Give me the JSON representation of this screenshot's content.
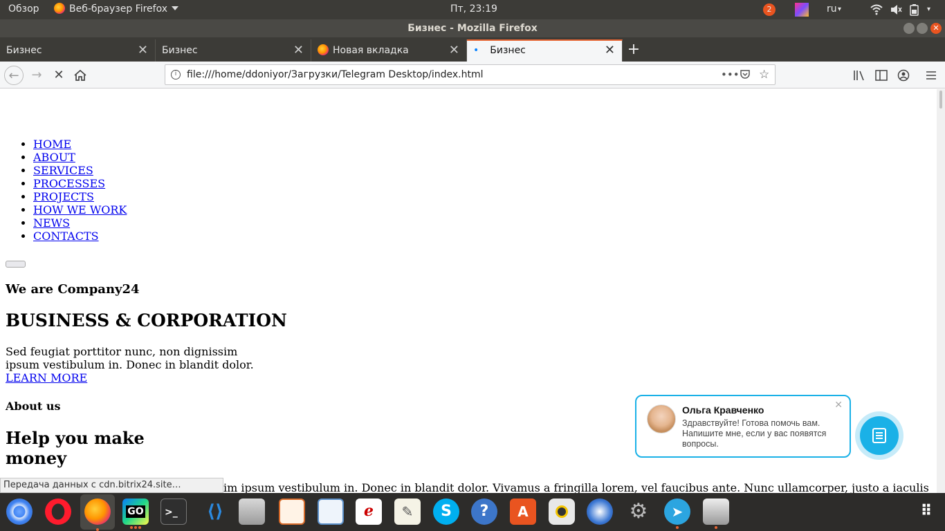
{
  "topbar": {
    "overview": "Обзор",
    "app_menu": "Веб-браузер Firefox",
    "clock": "Пт, 23:19",
    "notif_count": "2",
    "lang": "ru"
  },
  "window": {
    "title": "Бизнес - Mozilla Firefox"
  },
  "tabs": [
    {
      "label": "Бизнес"
    },
    {
      "label": "Бизнес"
    },
    {
      "label": "Новая вкладка"
    },
    {
      "label": "Бизнес"
    }
  ],
  "url": "file:///home/ddoniyor/Загрузки/Telegram Desktop/index.html",
  "page": {
    "nav": [
      "HOME",
      "ABOUT",
      "SERVICES",
      "PROCESSES",
      "PROJECTS",
      "HOW WE WORK",
      "NEWS",
      "CONTACTS"
    ],
    "hero_sub": "We are Company24",
    "hero_title": "BUSINESS & CORPORATION",
    "hero_text_1": "Sed feugiat porttitor nunc, non dignissim",
    "hero_text_2": "ipsum vestibulum in. Donec in blandit dolor.",
    "learn_more": "LEARN MORE",
    "about_label": "About us",
    "about_title_1": "Help you make",
    "about_title_2": "money",
    "about_text": "im ipsum vestibulum in. Donec in blandit dolor. Vivamus a fringilla lorem, vel faucibus ante. Nunc ullamcorper, justo a iaculis"
  },
  "chat": {
    "name": "Ольга Кравченко",
    "message": "Здравствуйте! Готова помочь вам. Напишите мне, если у вас появятся вопросы."
  },
  "status": "Передача данных с cdn.bitrix24.site…",
  "dock_icons": [
    "chromium-icon",
    "opera-icon",
    "firefox-icon",
    "goland-icon",
    "terminal-icon",
    "vscode-icon",
    "files-icon",
    "impress-icon",
    "image-viewer-icon",
    "document-viewer-icon",
    "text-editor-icon",
    "skype-icon",
    "help-icon",
    "software-center-icon",
    "rhythmbox-icon",
    "thunderbird-icon",
    "settings-icon",
    "telegram-icon",
    "printer-icon",
    "show-apps-icon"
  ]
}
